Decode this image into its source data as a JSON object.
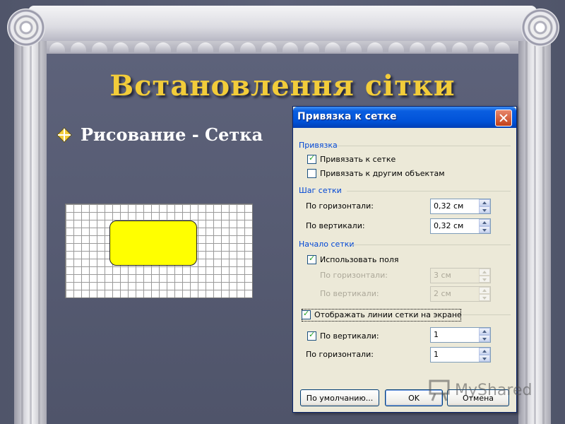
{
  "slide": {
    "title": "Встановлення сітки",
    "bullet_text": "Рисование - Сетка"
  },
  "dialog": {
    "title": "Привязка к сетке",
    "sections": {
      "snap": "Привязка",
      "spacing": "Шаг сетки",
      "origin": "Начало сетки"
    },
    "snap_to_grid_label": "Привязать к сетке",
    "snap_to_grid_checked": true,
    "snap_to_objects_label": "Привязать к другим объектам",
    "snap_to_objects_checked": false,
    "horizontal_spacing_label": "По горизонтали:",
    "horizontal_spacing_value": "0,32 см",
    "vertical_spacing_label": "По вертикали:",
    "vertical_spacing_value": "0,32 см",
    "use_margins_label": "Использовать поля",
    "use_margins_checked": true,
    "origin_horizontal_label": "По горизонтали:",
    "origin_horizontal_value": "3 см",
    "origin_vertical_label": "По вертикали:",
    "origin_vertical_value": "2 см",
    "display_gridlines_label": "Отображать линии сетки на экране",
    "display_gridlines_checked": true,
    "vertical_every_label": "По вертикали:",
    "vertical_every_checked": true,
    "vertical_every_value": "1",
    "horizontal_every_label": "По горизонтали:",
    "horizontal_every_value": "1",
    "buttons": {
      "default": "По умолчанию...",
      "ok": "OK",
      "cancel": "Отмена"
    }
  },
  "watermark": {
    "text": "MyShared"
  },
  "colors": {
    "title": "#f2cc3a",
    "shape_fill": "#ffff00",
    "titlebar": "#0052d8",
    "section_text": "#0046d5"
  }
}
